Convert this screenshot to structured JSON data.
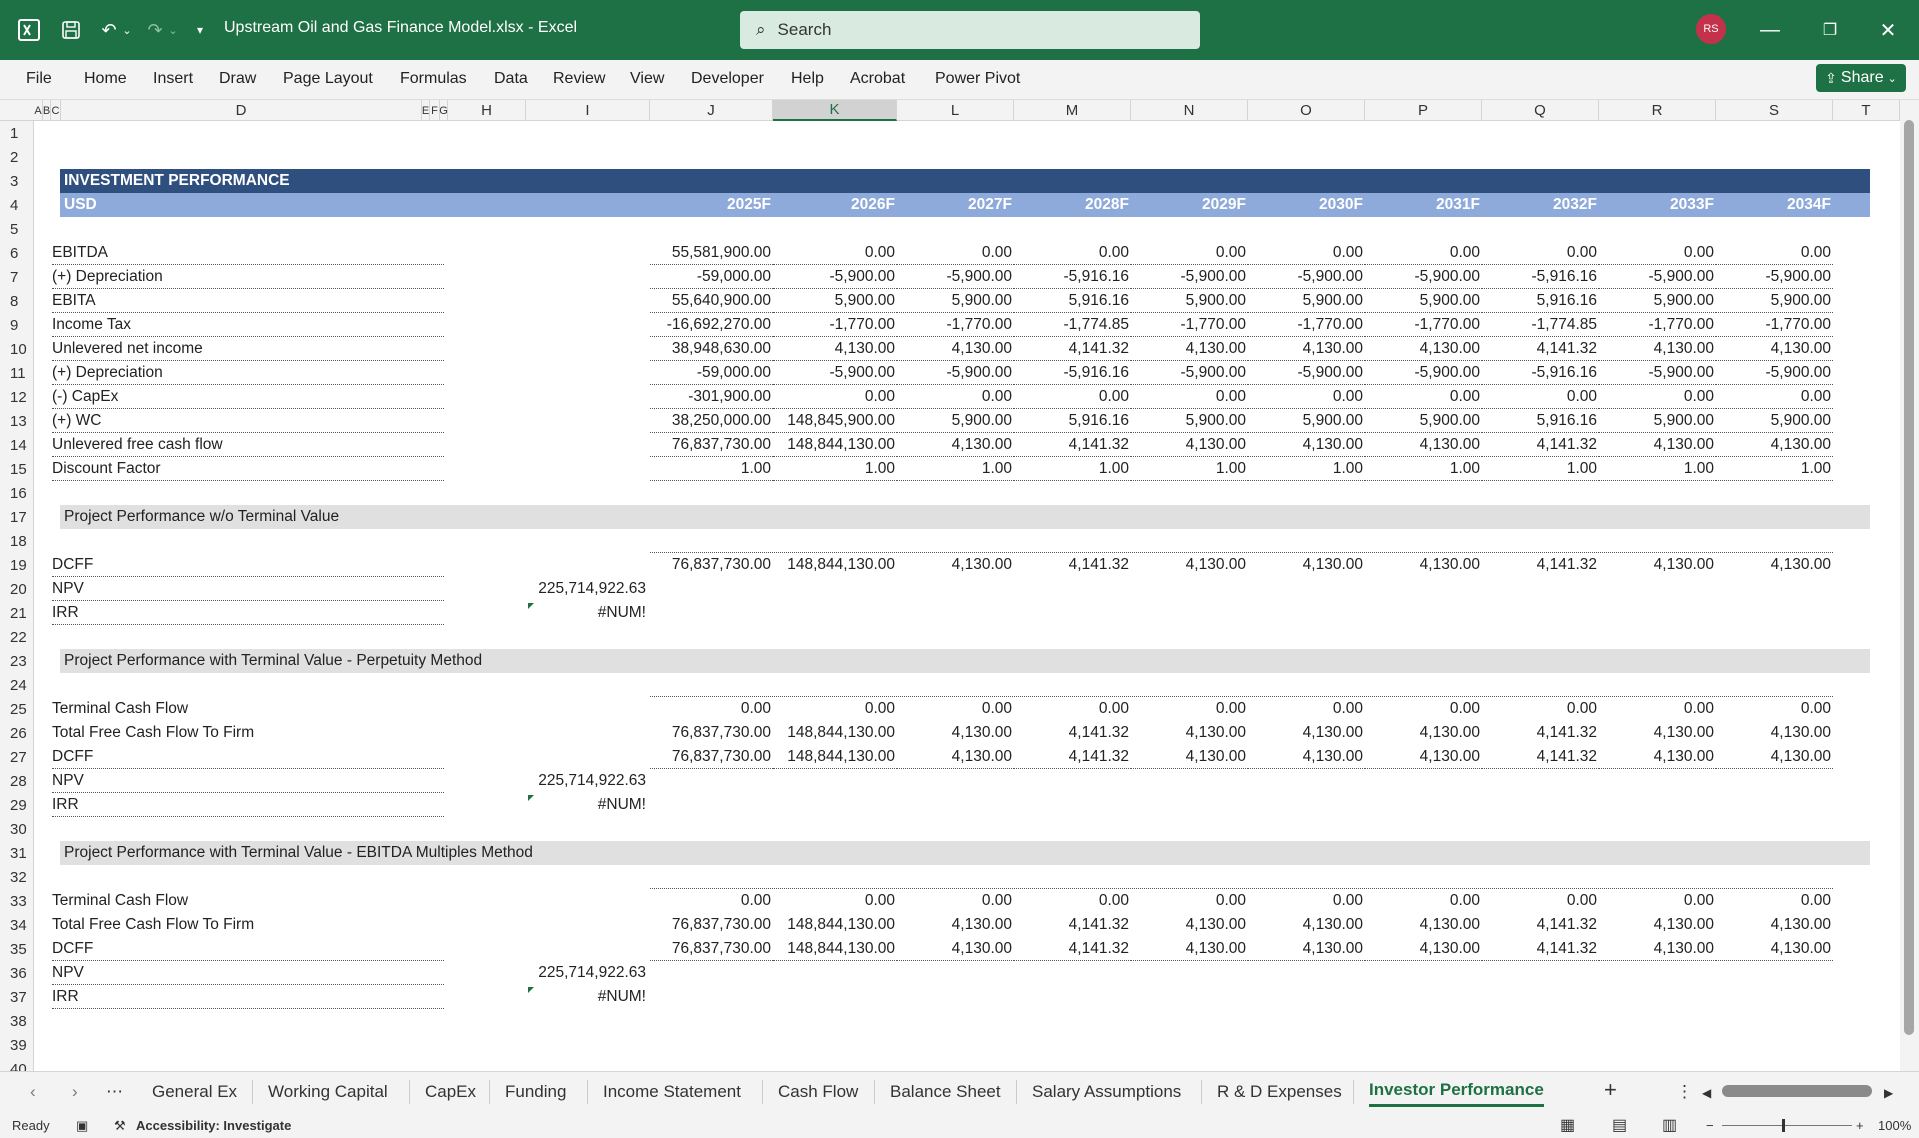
{
  "window": {
    "title": "Upstream Oil and Gas Finance Model.xlsx  -  Excel",
    "search_placeholder": "Search",
    "avatar_initials": "RS",
    "share_label": "Share",
    "accent_color": "#1e7145"
  },
  "ribbon": {
    "tabs": [
      "File",
      "Home",
      "Insert",
      "Draw",
      "Page Layout",
      "Formulas",
      "Data",
      "Review",
      "View",
      "Developer",
      "Help",
      "Acrobat",
      "Power Pivot"
    ]
  },
  "columns": {
    "headers": [
      "A",
      "B",
      "C",
      "D",
      "E",
      "F",
      "G",
      "H",
      "I",
      "J",
      "K",
      "L",
      "M",
      "N",
      "O",
      "P",
      "Q",
      "R",
      "S",
      "T"
    ],
    "selected": "K"
  },
  "rows": [
    "1",
    "2",
    "3",
    "4",
    "5",
    "6",
    "7",
    "8",
    "9",
    "10",
    "11",
    "12",
    "13",
    "14",
    "15",
    "16",
    "17",
    "18",
    "19",
    "20",
    "21",
    "22",
    "23",
    "24",
    "25",
    "26",
    "27",
    "28",
    "29",
    "30",
    "31",
    "32",
    "33",
    "34",
    "35",
    "36",
    "37",
    "38",
    "39",
    "40"
  ],
  "sheet": {
    "title": "INVESTMENT PERFORMANCE",
    "currency": "USD",
    "years": [
      "2025F",
      "2026F",
      "2027F",
      "2028F",
      "2029F",
      "2030F",
      "2031F",
      "2032F",
      "2033F",
      "2034F"
    ],
    "main_rows": [
      {
        "label": "EBITDA",
        "values": [
          "55,581,900.00",
          "0.00",
          "0.00",
          "0.00",
          "0.00",
          "0.00",
          "0.00",
          "0.00",
          "0.00",
          "0.00"
        ]
      },
      {
        "label": "(+) Depreciation",
        "values": [
          "-59,000.00",
          "-5,900.00",
          "-5,900.00",
          "-5,916.16",
          "-5,900.00",
          "-5,900.00",
          "-5,900.00",
          "-5,916.16",
          "-5,900.00",
          "-5,900.00"
        ]
      },
      {
        "label": "EBITA",
        "values": [
          "55,640,900.00",
          "5,900.00",
          "5,900.00",
          "5,916.16",
          "5,900.00",
          "5,900.00",
          "5,900.00",
          "5,916.16",
          "5,900.00",
          "5,900.00"
        ]
      },
      {
        "label": "Income Tax",
        "values": [
          "-16,692,270.00",
          "-1,770.00",
          "-1,770.00",
          "-1,774.85",
          "-1,770.00",
          "-1,770.00",
          "-1,770.00",
          "-1,774.85",
          "-1,770.00",
          "-1,770.00"
        ]
      },
      {
        "label": "Unlevered net income",
        "values": [
          "38,948,630.00",
          "4,130.00",
          "4,130.00",
          "4,141.32",
          "4,130.00",
          "4,130.00",
          "4,130.00",
          "4,141.32",
          "4,130.00",
          "4,130.00"
        ]
      },
      {
        "label": "(+) Depreciation",
        "values": [
          "-59,000.00",
          "-5,900.00",
          "-5,900.00",
          "-5,916.16",
          "-5,900.00",
          "-5,900.00",
          "-5,900.00",
          "-5,916.16",
          "-5,900.00",
          "-5,900.00"
        ]
      },
      {
        "label": "(-) CapEx",
        "values": [
          "-301,900.00",
          "0.00",
          "0.00",
          "0.00",
          "0.00",
          "0.00",
          "0.00",
          "0.00",
          "0.00",
          "0.00"
        ]
      },
      {
        "label": "(+) WC",
        "values": [
          "38,250,000.00",
          "148,845,900.00",
          "5,900.00",
          "5,916.16",
          "5,900.00",
          "5,900.00",
          "5,900.00",
          "5,916.16",
          "5,900.00",
          "5,900.00"
        ]
      },
      {
        "label": "Unlevered free cash flow",
        "values": [
          "76,837,730.00",
          "148,844,130.00",
          "4,130.00",
          "4,141.32",
          "4,130.00",
          "4,130.00",
          "4,130.00",
          "4,141.32",
          "4,130.00",
          "4,130.00"
        ]
      },
      {
        "label": "Discount Factor",
        "values": [
          "1.00",
          "1.00",
          "1.00",
          "1.00",
          "1.00",
          "1.00",
          "1.00",
          "1.00",
          "1.00",
          "1.00"
        ]
      }
    ],
    "sec1": {
      "title": "Project Performance w/o Terminal Value",
      "dcff_label": "DCFF",
      "dcff": [
        "76,837,730.00",
        "148,844,130.00",
        "4,130.00",
        "4,141.32",
        "4,130.00",
        "4,130.00",
        "4,130.00",
        "4,141.32",
        "4,130.00",
        "4,130.00"
      ],
      "npv_label": "NPV",
      "npv": "225,714,922.63",
      "irr_label": "IRR",
      "irr": "#NUM!"
    },
    "sec2": {
      "title": "Project Performance with Terminal Value - Perpetuity Method",
      "tcf_label": "Terminal Cash Flow",
      "tcf": [
        "0.00",
        "0.00",
        "0.00",
        "0.00",
        "0.00",
        "0.00",
        "0.00",
        "0.00",
        "0.00",
        "0.00"
      ],
      "tfcf_label": "Total Free Cash Flow To Firm",
      "tfcf": [
        "76,837,730.00",
        "148,844,130.00",
        "4,130.00",
        "4,141.32",
        "4,130.00",
        "4,130.00",
        "4,130.00",
        "4,141.32",
        "4,130.00",
        "4,130.00"
      ],
      "dcff_label": "DCFF",
      "dcff": [
        "76,837,730.00",
        "148,844,130.00",
        "4,130.00",
        "4,141.32",
        "4,130.00",
        "4,130.00",
        "4,130.00",
        "4,141.32",
        "4,130.00",
        "4,130.00"
      ],
      "npv_label": "NPV",
      "npv": "225,714,922.63",
      "irr_label": "IRR",
      "irr": "#NUM!"
    },
    "sec3": {
      "title": "Project Performance with Terminal Value - EBITDA Multiples Method",
      "tcf_label": "Terminal Cash Flow",
      "tcf": [
        "0.00",
        "0.00",
        "0.00",
        "0.00",
        "0.00",
        "0.00",
        "0.00",
        "0.00",
        "0.00",
        "0.00"
      ],
      "tfcf_label": "Total Free Cash Flow To Firm",
      "tfcf": [
        "76,837,730.00",
        "148,844,130.00",
        "4,130.00",
        "4,141.32",
        "4,130.00",
        "4,130.00",
        "4,130.00",
        "4,141.32",
        "4,130.00",
        "4,130.00"
      ],
      "dcff_label": "DCFF",
      "dcff": [
        "76,837,730.00",
        "148,844,130.00",
        "4,130.00",
        "4,141.32",
        "4,130.00",
        "4,130.00",
        "4,130.00",
        "4,141.32",
        "4,130.00",
        "4,130.00"
      ],
      "npv_label": "NPV",
      "npv": "225,714,922.63",
      "irr_label": "IRR",
      "irr": "#NUM!"
    }
  },
  "sheet_tabs": [
    "General Ex",
    "Working Capital",
    "CapEx",
    "Funding",
    "Income Statement",
    "Cash Flow",
    "Balance Sheet",
    "Salary Assumptions",
    "R & D Expenses",
    "Investor Performance"
  ],
  "active_sheet_tab": "Investor Performance",
  "status": {
    "ready": "Ready",
    "accessibility": "Accessibility: Investigate",
    "zoom": "100%"
  }
}
